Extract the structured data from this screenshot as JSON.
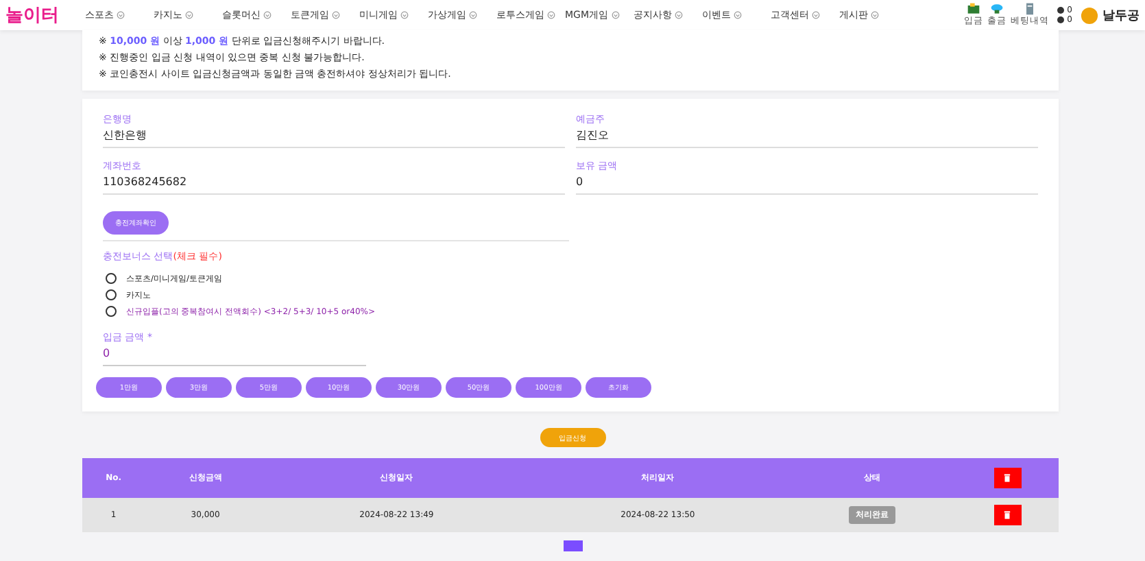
{
  "header": {
    "logo": "놀이터",
    "menu": [
      "스포츠",
      "카지노",
      "슬롯머신",
      "토큰게임",
      "미니게임",
      "가상게임",
      "로투스게임",
      "MGM게임",
      "공지사항",
      "이벤트",
      "고객센터",
      "게시판"
    ],
    "quick": [
      {
        "kind": "deposit",
        "label": "입금"
      },
      {
        "kind": "withdraw",
        "label": "출금"
      },
      {
        "kind": "history",
        "label": "베팅내역"
      }
    ],
    "counters": [
      "0",
      "0"
    ],
    "user": "날두공"
  },
  "notices": [
    {
      "prefix": "※ ",
      "amount1": "10,000 원",
      "middle": " 이상 ",
      "amount2": "1,000 원",
      "rest": " 단위로 입금신청해주시기 바랍니다."
    },
    {
      "prefix": "※ ",
      "rest": "진행중인 입금 신청 내역이 있으면 중복 신청 불가능합니다."
    },
    {
      "prefix": "※ ",
      "rest": "코인충전시 사이트 입금신청금액과 동일한 금액 충전하셔야 정상처리가 됩니다."
    }
  ],
  "form": {
    "bank_label": "은행명",
    "bank_value": "신한은행",
    "holder_label": "예금주",
    "holder_value": "김진오",
    "account_label": "계좌번호",
    "account_value": "110368245682",
    "balance_label": "보유 금액",
    "balance_value": "0",
    "check_button": "충전계좌확인",
    "bonus_label": "충전보너스 선택",
    "bonus_required": "(체크 필수)",
    "bonus_options": [
      {
        "label": "스포츠/미니게임/토큰게임",
        "selected": false,
        "highlight": false
      },
      {
        "label": "카지노",
        "selected": false,
        "highlight": false
      },
      {
        "label": "신규입플(고의 중복참여시 전액회수) <3+2/ 5+3/ 10+5 or40%>",
        "selected": false,
        "highlight": true
      }
    ],
    "amount_label": "입금 금액 *",
    "amount_value": "0",
    "amount_buttons": [
      "1만원",
      "3만원",
      "5만원",
      "10만원",
      "30만원",
      "50만원",
      "100만원",
      "초기화"
    ]
  },
  "submit_button": "입금신청",
  "table": {
    "columns": [
      "No.",
      "신청금액",
      "신청일자",
      "처리일자",
      "상태"
    ],
    "rows": [
      {
        "no": "1",
        "amount": "30,000",
        "requested": "2024-08-22 13:49",
        "processed": "2024-08-22 13:50",
        "status": "처리완료"
      }
    ]
  }
}
